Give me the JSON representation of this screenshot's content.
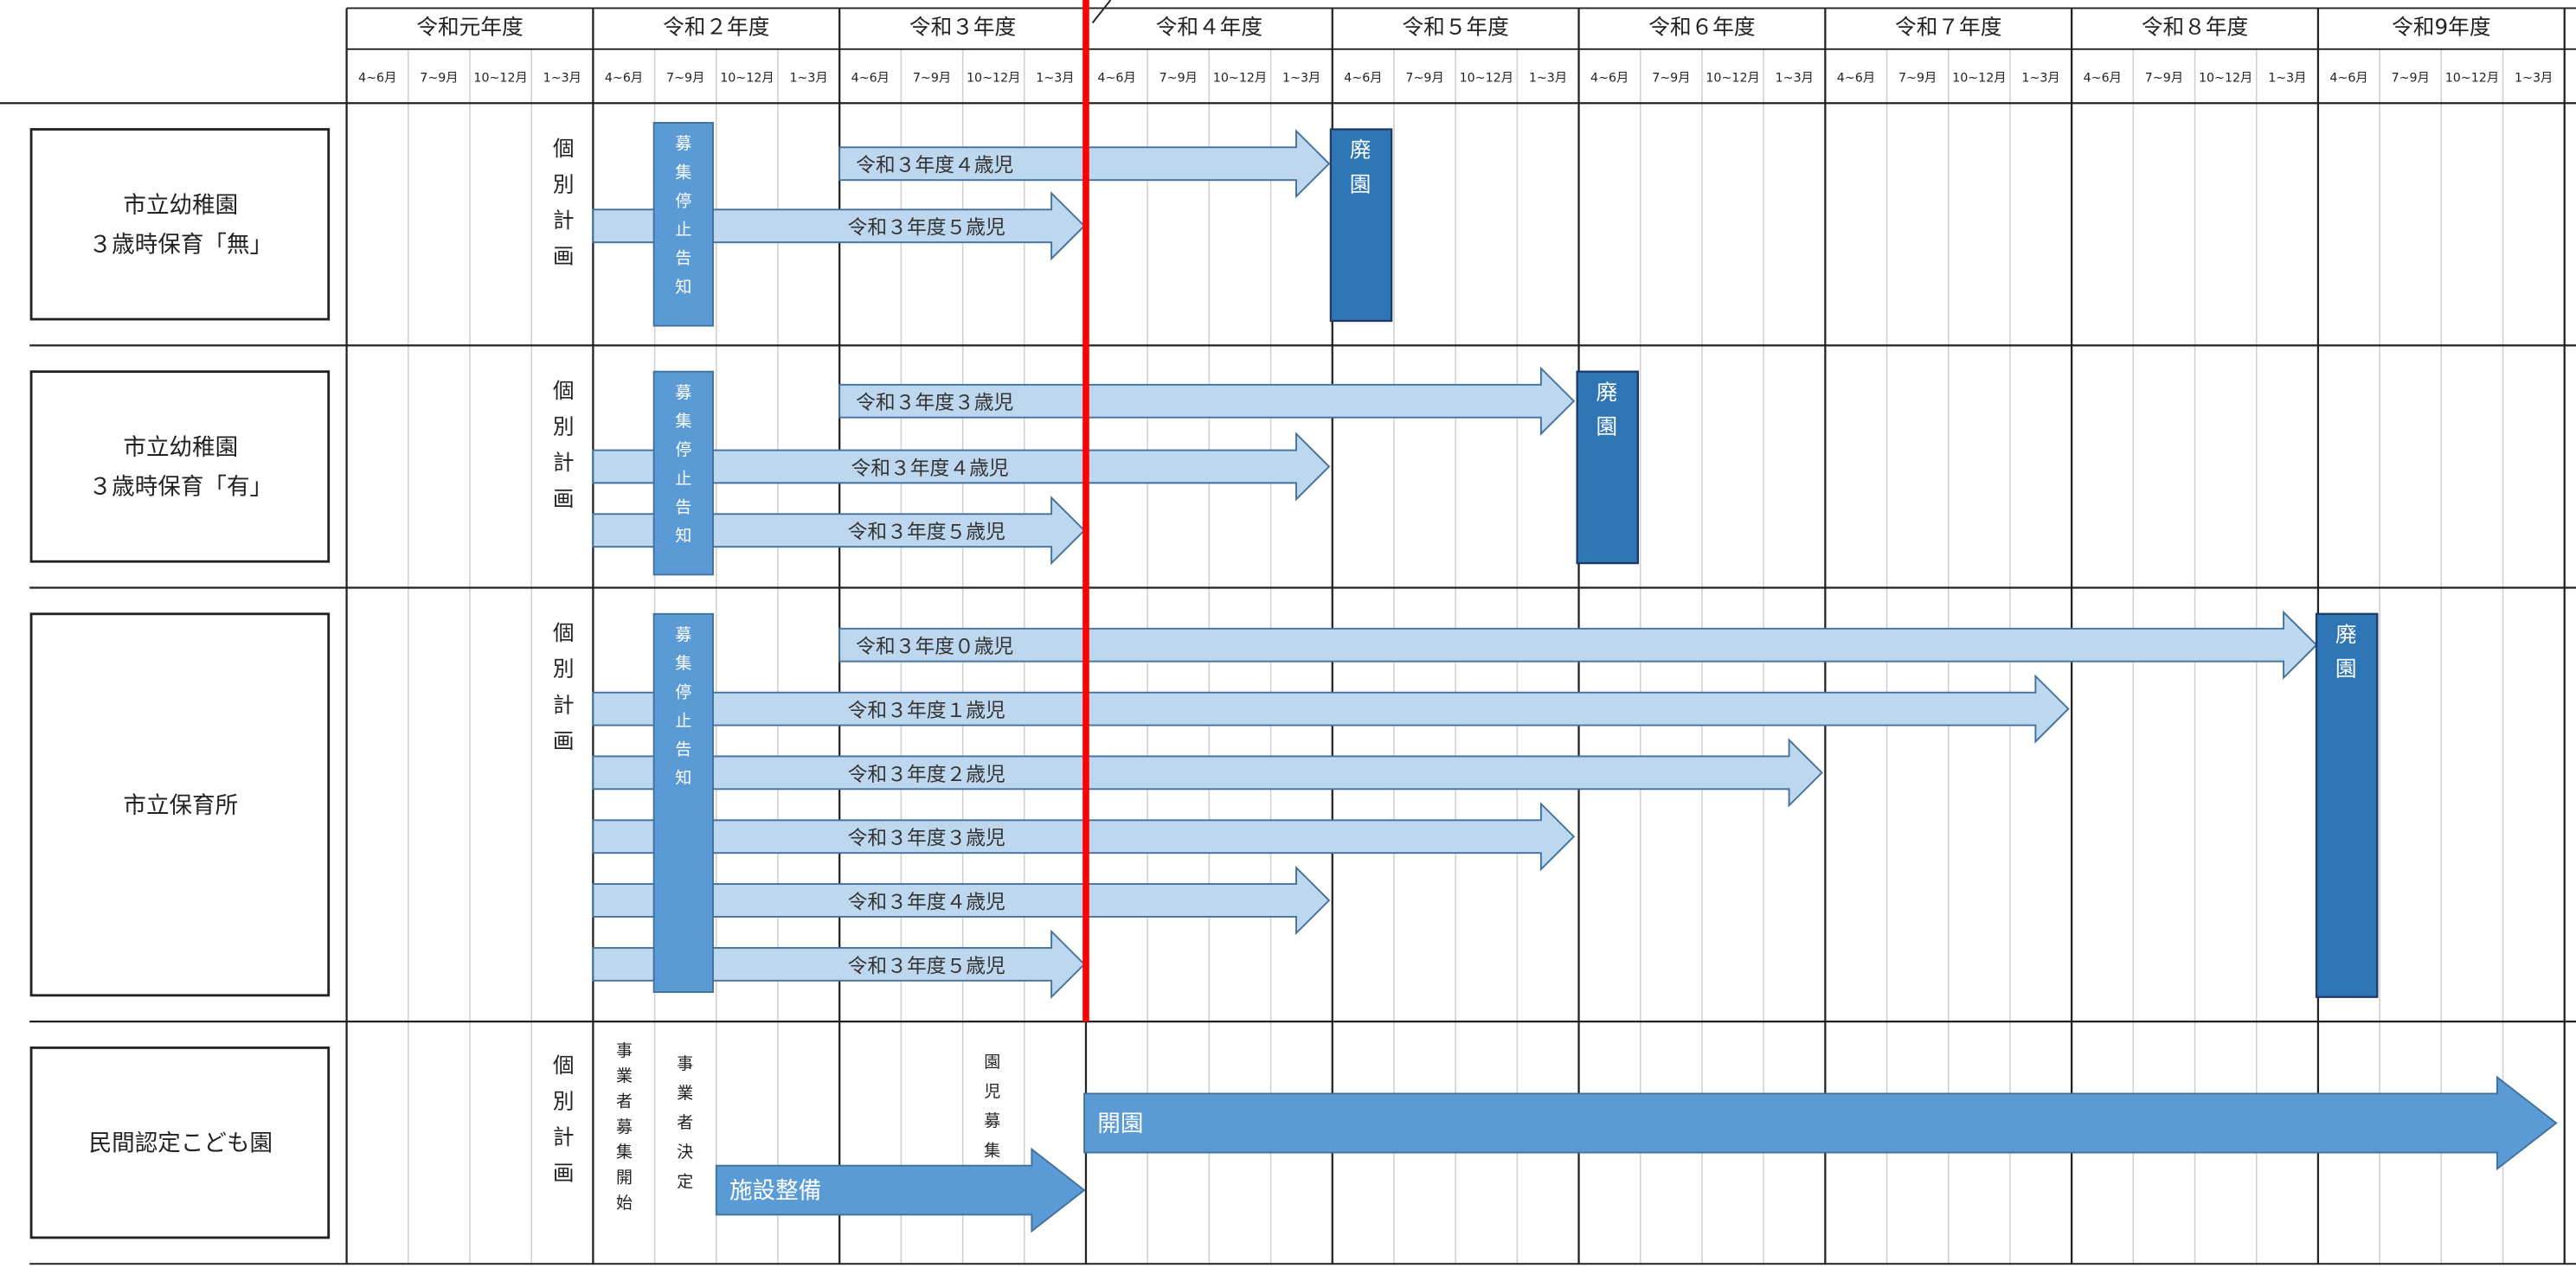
{
  "years": [
    "令和元年度",
    "令和２年度",
    "令和３年度",
    "令和４年度",
    "令和５年度",
    "令和６年度",
    "令和７年度",
    "令和８年度",
    "令和9年度"
  ],
  "quarters": [
    "4~6月",
    "7~9月",
    "10~12月",
    "1~3月"
  ],
  "rows": [
    {
      "label_lines": [
        "市立幼稚園",
        "３歳時保育「無」"
      ]
    },
    {
      "label_lines": [
        "市立幼稚園",
        "３歳時保育「有」"
      ]
    },
    {
      "label_lines": [
        "市立保育所"
      ]
    },
    {
      "label_lines": [
        "民間認定こども園"
      ]
    }
  ],
  "individual_plan": [
    "個",
    "別",
    "計",
    "画"
  ],
  "notice_text": [
    "募",
    "集",
    "停",
    "止",
    "告",
    "知"
  ],
  "closure_text": [
    "廃",
    "園"
  ],
  "arrows": [
    {
      "label": "令和３年度４歳児"
    },
    {
      "label": "令和３年度５歳児"
    },
    {
      "label": "令和３年度３歳児"
    },
    {
      "label": "令和３年度４歳児"
    },
    {
      "label": "令和３年度５歳児"
    },
    {
      "label": "令和３年度０歳児"
    },
    {
      "label": "令和３年度１歳児"
    },
    {
      "label": "令和３年度２歳児"
    },
    {
      "label": "令和３年度３歳児"
    },
    {
      "label": "令和３年度４歳児"
    },
    {
      "label": "令和３年度５歳児"
    }
  ],
  "private": {
    "operator_recruit": [
      "事",
      "業",
      "者",
      "募",
      "集",
      "開",
      "始"
    ],
    "operator_decided": [
      "事",
      "業",
      "者",
      "決",
      "定"
    ],
    "child_recruit": [
      "園",
      "児",
      "募",
      "集"
    ],
    "facility_label": "施設整備",
    "open_label": "開園"
  },
  "colors": {
    "light_arrow": "#bdd7ee",
    "dark_box": "#2e75b6",
    "mid_box": "#5b9bd5",
    "today_line": "#ff0000"
  }
}
